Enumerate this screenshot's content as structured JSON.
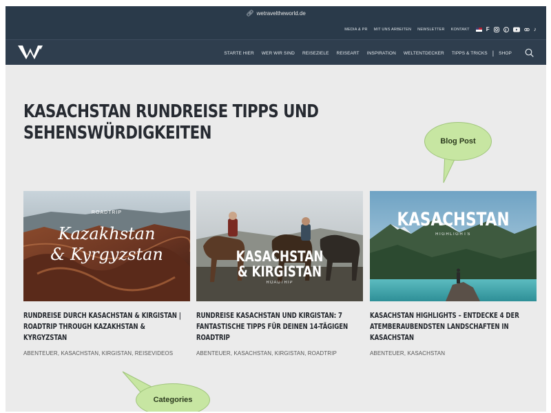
{
  "url": "wetraveltheworld.de",
  "utility_nav": [
    "Media & PR",
    "Mit uns arbeiten",
    "Newsletter",
    "Kontakt"
  ],
  "social_icons": [
    "flag-icon",
    "facebook-icon",
    "instagram-icon",
    "pinterest-icon",
    "youtube-icon",
    "link-icon",
    "tiktok-icon"
  ],
  "main_nav": [
    "Starte hier",
    "Wer wir sind",
    "Reiseziele",
    "Reiseart",
    "Inspiration",
    "Weltentdecker",
    "Tipps & Tricks",
    "Shop"
  ],
  "headline": "KASACHSTAN RUNDREISE TIPPS UND SEHENSWÜRDIGKEITEN",
  "posts": [
    {
      "image_kicker": "ROADTRIP",
      "image_text_line1": "Kazakhstan",
      "image_text_line2": "& Kyrgyzstan",
      "title": "Rundreise durch Kasachstan & Kirgistan | Roadtrip through Kazakhstan & Kyrgyzstan",
      "categories": "Abenteuer, Kasachstan, Kirgistan, Reisevideos"
    },
    {
      "image_text_line1": "KASACHSTAN",
      "image_text_line2": "& KIRGISTAN",
      "image_kicker": "ROADTRIP",
      "title": "Rundreise Kasachstan und Kirgistan: 7 fantastische Tipps für deinen 14-tägigen Roadtrip",
      "categories": "Abenteuer, Kasachstan, Kirgistan, Roadtrip"
    },
    {
      "image_text_line1": "KASACHSTAN",
      "image_kicker": "HIGHLIGHTS",
      "title": "Kasachstan Highlights – Entdecke 4 der atemberaubendsten Landschaften in Kasachstan",
      "categories": "Abenteuer, Kasachstan"
    }
  ],
  "annotations": {
    "blog_post": "Blog Post",
    "categories": "Categories"
  },
  "colors": {
    "header_bg": "#2a3a4a",
    "page_bg": "#ebebeb",
    "annotation_fill": "#c7e6a2"
  }
}
